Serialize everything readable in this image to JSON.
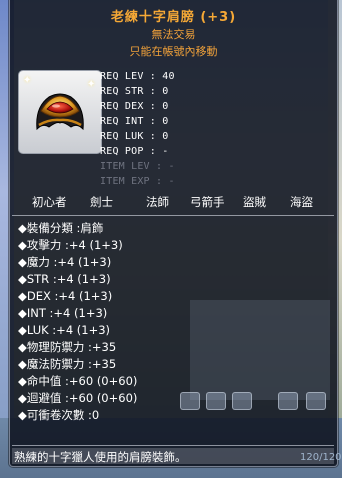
{
  "item": {
    "name": "老練十字肩膀 (+3)",
    "trade_status": "無法交易",
    "move_status": "只能在帳號內移動",
    "icon": "pauldron-icon"
  },
  "requirements": [
    {
      "label": "REQ LEV",
      "value": "40",
      "dim": false
    },
    {
      "label": "REQ STR",
      "value": "0",
      "dim": false
    },
    {
      "label": "REQ DEX",
      "value": "0",
      "dim": false
    },
    {
      "label": "REQ INT",
      "value": "0",
      "dim": false
    },
    {
      "label": "REQ LUK",
      "value": "0",
      "dim": false
    },
    {
      "label": "REQ POP",
      "value": "-",
      "dim": false
    },
    {
      "label": "ITEM LEV",
      "value": "-",
      "dim": true
    },
    {
      "label": "ITEM EXP",
      "value": "-",
      "dim": true
    }
  ],
  "jobs": [
    "初心者",
    "劍士",
    "法師",
    "弓箭手",
    "盜賊",
    "海盜"
  ],
  "stats": [
    "裝備分類 :肩飾",
    "攻擊力 :+4 (1+3)",
    "魔力 :+4 (1+3)",
    "STR :+4 (1+3)",
    "DEX :+4 (1+3)",
    "INT :+4 (1+3)",
    "LUK :+4 (1+3)",
    "物理防禦力 :+35",
    "魔法防禦力 :+35",
    "命中值 :+60 (0+60)",
    "迴避值 :+60 (0+60)",
    "可衝卷次數 :0"
  ],
  "description": "熟練的十字獵人使用的肩膀裝飾。",
  "background_counter": "120/120",
  "colors": {
    "title": "#f5a836",
    "text": "#ffffff",
    "dim": "#6f7380",
    "panel": "#0c101c"
  }
}
